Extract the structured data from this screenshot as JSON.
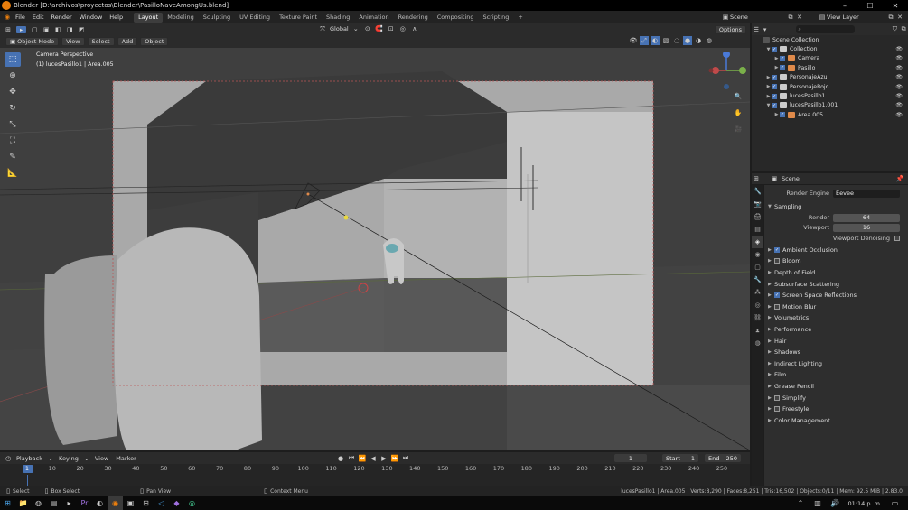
{
  "titlebar": {
    "title": "Blender [D:\\archivos\\proyectos\\Blender\\PasilloNaveAmongUs.blend]"
  },
  "menu": [
    "File",
    "Edit",
    "Render",
    "Window",
    "Help"
  ],
  "workspaces": [
    "Layout",
    "Modeling",
    "Sculpting",
    "UV Editing",
    "Texture Paint",
    "Shading",
    "Animation",
    "Rendering",
    "Compositing",
    "Scripting"
  ],
  "scene_name": "Scene",
  "view_layer": "View Layer",
  "viewport_header": {
    "mode": "Object Mode",
    "view": "View",
    "select": "Select",
    "add": "Add",
    "object": "Object",
    "orientation": "Global",
    "options": "Options"
  },
  "viewport": {
    "perspective": "Camera Perspective",
    "context": "(1) lucesPasillo1 | Area.005"
  },
  "outliner": {
    "root": "Scene Collection",
    "items": [
      {
        "name": "Collection",
        "depth": 1,
        "expanded": true,
        "color": "#cccccc"
      },
      {
        "name": "Camera",
        "depth": 2,
        "color": "#e08a4a"
      },
      {
        "name": "Pasillo",
        "depth": 2,
        "color": "#e08a4a"
      },
      {
        "name": "PersonajeAzul",
        "depth": 1,
        "color": "#cccccc"
      },
      {
        "name": "PersonajeRojo",
        "depth": 1,
        "color": "#cccccc"
      },
      {
        "name": "lucesPasillo1",
        "depth": 1,
        "color": "#cccccc"
      },
      {
        "name": "lucesPasillo1.001",
        "depth": 1,
        "expanded": true,
        "color": "#cccccc"
      },
      {
        "name": "Area.005",
        "depth": 2,
        "color": "#e08a4a"
      }
    ]
  },
  "properties": {
    "title": "Scene",
    "render_engine_label": "Render Engine",
    "render_engine": "Eevee",
    "sampling": "Sampling",
    "render_label": "Render",
    "render_value": "64",
    "viewport_label": "Viewport",
    "viewport_value": "16",
    "viewport_denoising": "Viewport Denoising",
    "panels": [
      {
        "label": "Ambient Occlusion",
        "checkbox": true,
        "checked": true
      },
      {
        "label": "Bloom",
        "checkbox": true,
        "checked": false
      },
      {
        "label": "Depth of Field",
        "checkbox": false
      },
      {
        "label": "Subsurface Scattering",
        "checkbox": false
      },
      {
        "label": "Screen Space Reflections",
        "checkbox": true,
        "checked": true
      },
      {
        "label": "Motion Blur",
        "checkbox": true,
        "checked": false
      },
      {
        "label": "Volumetrics",
        "checkbox": false
      },
      {
        "label": "Performance",
        "checkbox": false
      },
      {
        "label": "Hair",
        "checkbox": false
      },
      {
        "label": "Shadows",
        "checkbox": false
      },
      {
        "label": "Indirect Lighting",
        "checkbox": false
      },
      {
        "label": "Film",
        "checkbox": false
      },
      {
        "label": "Grease Pencil",
        "checkbox": false
      },
      {
        "label": "Simplify",
        "checkbox": true,
        "checked": false
      },
      {
        "label": "Freestyle",
        "checkbox": true,
        "checked": false
      },
      {
        "label": "Color Management",
        "checkbox": false
      }
    ]
  },
  "timeline": {
    "playback": "Playback",
    "keying": "Keying",
    "view": "View",
    "marker": "Marker",
    "current_frame": "1",
    "start_label": "Start",
    "start": "1",
    "end_label": "End",
    "end": "250",
    "ticks": [
      "1",
      "10",
      "20",
      "30",
      "40",
      "50",
      "60",
      "70",
      "80",
      "90",
      "100",
      "110",
      "120",
      "130",
      "140",
      "150",
      "160",
      "170",
      "180",
      "190",
      "200",
      "210",
      "220",
      "230",
      "240",
      "250"
    ]
  },
  "statusbar": {
    "select": "Select",
    "box_select": "Box Select",
    "pan_view": "Pan View",
    "context_menu": "Context Menu",
    "stats": "lucesPasillo1 | Area.005 | Verts:8,290 | Faces:8,251 | Tris:16,502 | Objects:0/11 | Mem: 92.5 MiB | 2.83.0"
  },
  "taskbar": {
    "time": "01:14 p. m."
  }
}
